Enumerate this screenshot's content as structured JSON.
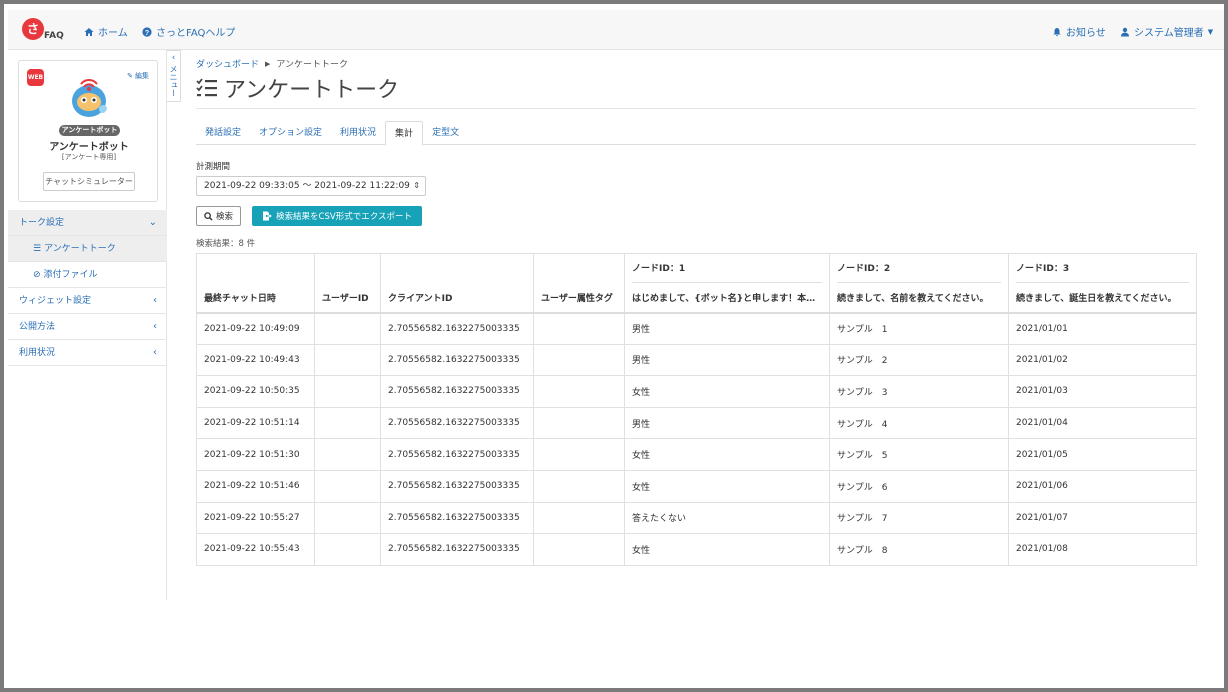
{
  "nav": {
    "logo_mark": "さ",
    "logo_text": "FAQ",
    "home": "ホーム",
    "help": "さっとFAQヘルプ",
    "notices": "お知らせ",
    "user": "システム管理者"
  },
  "sidebar": {
    "web_badge": "WEB",
    "edit": "編集",
    "bot_tag": "アンケートボット",
    "bot_name": "アンケートボット",
    "bot_sub": "[アンケート専用]",
    "simulator": "チャットシミュレーター",
    "collapse_label": "メニュー",
    "menu": [
      {
        "label": "トーク設定",
        "open": true
      },
      {
        "label": "ウィジェット設定"
      },
      {
        "label": "公開方法"
      },
      {
        "label": "利用状況"
      }
    ],
    "sub_items": [
      {
        "label": "アンケートトーク",
        "active": true
      },
      {
        "label": "添付ファイル"
      }
    ]
  },
  "main": {
    "breadcrumb": [
      "ダッシュボード",
      "アンケートトーク"
    ],
    "title": "アンケートトーク",
    "tabs": [
      {
        "label": "発話設定"
      },
      {
        "label": "オプション設定"
      },
      {
        "label": "利用状況"
      },
      {
        "label": "集計",
        "active": true
      },
      {
        "label": "定型文"
      }
    ],
    "period_label": "計測期間",
    "period_value": "2021-09-22 09:33:05 〜 2021-09-22 11:22:09",
    "search_button": "検索",
    "export_button": "検索結果をCSV形式でエクスポート",
    "result_count": "検索結果：8 件"
  },
  "table": {
    "headers": [
      {
        "label": "最終チャット日時"
      },
      {
        "label": "ユーザーID"
      },
      {
        "label": "クライアントID"
      },
      {
        "label": "ユーザー属性タグ"
      },
      {
        "node": "ノードID：1",
        "label": "はじめまして、{ボット名}と申します！本…"
      },
      {
        "node": "ノードID：2",
        "label": "続きまして、名前を教えてください。"
      },
      {
        "node": "ノードID：3",
        "label": "続きまして、誕生日を教えてください。"
      }
    ],
    "rows": [
      [
        "2021-09-22 10:49:09",
        "",
        "2.70556582.1632275003335",
        "",
        "男性",
        "サンプル　1",
        "2021/01/01"
      ],
      [
        "2021-09-22 10:49:43",
        "",
        "2.70556582.1632275003335",
        "",
        "男性",
        "サンプル　2",
        "2021/01/02"
      ],
      [
        "2021-09-22 10:50:35",
        "",
        "2.70556582.1632275003335",
        "",
        "女性",
        "サンプル　3",
        "2021/01/03"
      ],
      [
        "2021-09-22 10:51:14",
        "",
        "2.70556582.1632275003335",
        "",
        "男性",
        "サンプル　4",
        "2021/01/04"
      ],
      [
        "2021-09-22 10:51:30",
        "",
        "2.70556582.1632275003335",
        "",
        "女性",
        "サンプル　5",
        "2021/01/05"
      ],
      [
        "2021-09-22 10:51:46",
        "",
        "2.70556582.1632275003335",
        "",
        "女性",
        "サンプル　6",
        "2021/01/06"
      ],
      [
        "2021-09-22 10:55:27",
        "",
        "2.70556582.1632275003335",
        "",
        "答えたくない",
        "サンプル　7",
        "2021/01/07"
      ],
      [
        "2021-09-22 10:55:43",
        "",
        "2.70556582.1632275003335",
        "",
        "女性",
        "サンプル　8",
        "2021/01/08"
      ]
    ]
  },
  "colors": {
    "link": "#2a6fb6",
    "brand_red": "#e8383d",
    "export_teal": "#17a2b8"
  }
}
